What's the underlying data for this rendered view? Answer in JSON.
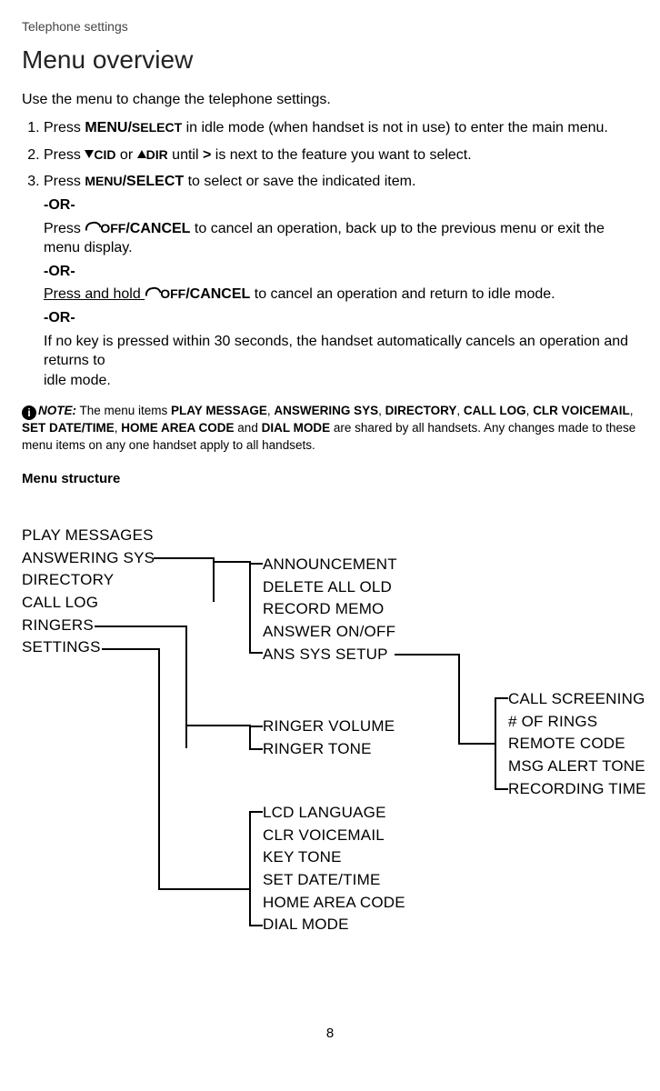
{
  "breadcrumb": "Telephone settings",
  "title": "Menu overview",
  "intro": "Use the menu to change the telephone settings.",
  "steps": {
    "s1": {
      "pre": "Press ",
      "bold1": "MENU/",
      "bold2": "SELECT",
      "post": " in idle mode (when handset is not in use) to enter the main menu."
    },
    "s2": {
      "pre": "Press ",
      "cid": "CID",
      "or": " or ",
      "dir": "DIR",
      "mid": " until ",
      "gt": ">",
      "post": " is next to the feature you want to select."
    },
    "s3": {
      "pre": "Press ",
      "menu": "MENU",
      "select": "/SELECT",
      "post": " to select or save the indicated item."
    },
    "or": "-OR-",
    "cancel1": {
      "pre": "Press ",
      "off": "OFF",
      "cancel": "/CANCEL",
      "post": " to cancel an operation, back up to the previous menu or exit the menu display."
    },
    "cancel2": {
      "pre": "Press and hold ",
      "off": "OFF",
      "cancel": "/CANCEL",
      "post": " to cancel an operation and return to idle mode."
    },
    "idle": "If no key is pressed within 30 seconds, the handset automatically cancels an operation and returns to",
    "idle2": "idle mode."
  },
  "note": {
    "label": "NOTE:",
    "pre": " The menu items ",
    "b1": "PLAY MESSAGE",
    "c": ", ",
    "b2": "ANSWERING SYS",
    "b3": "DIRECTORY",
    "b4": "CALL LOG",
    "b5": "CLR VOICEMAIL",
    "b6": "SET DATE/TIME",
    "b7": "HOME AREA CODE",
    "and": " and ",
    "b8": "DIAL MODE",
    "post": " are shared by all handsets. Any changes made to these menu items on any one handset apply to all handsets."
  },
  "menu_structure_label": "Menu structure",
  "main_menu": [
    "PLAY MESSAGES",
    "ANSWERING SYS",
    "DIRECTORY",
    "CALL LOG",
    "RINGERS",
    "SETTINGS"
  ],
  "answering": [
    "ANNOUNCEMENT",
    "DELETE ALL OLD",
    "RECORD MEMO",
    "ANSWER ON/OFF",
    "ANS SYS SETUP"
  ],
  "ringers": [
    "RINGER VOLUME",
    "RINGER TONE"
  ],
  "settings": [
    "LCD LANGUAGE",
    "CLR VOICEMAIL",
    "KEY TONE",
    "SET DATE/TIME",
    "HOME AREA CODE",
    "DIAL MODE"
  ],
  "sys_setup": [
    "CALL SCREENING",
    "# OF RINGS",
    "REMOTE CODE",
    "MSG ALERT TONE",
    "RECORDING TIME"
  ],
  "page_number": "8"
}
